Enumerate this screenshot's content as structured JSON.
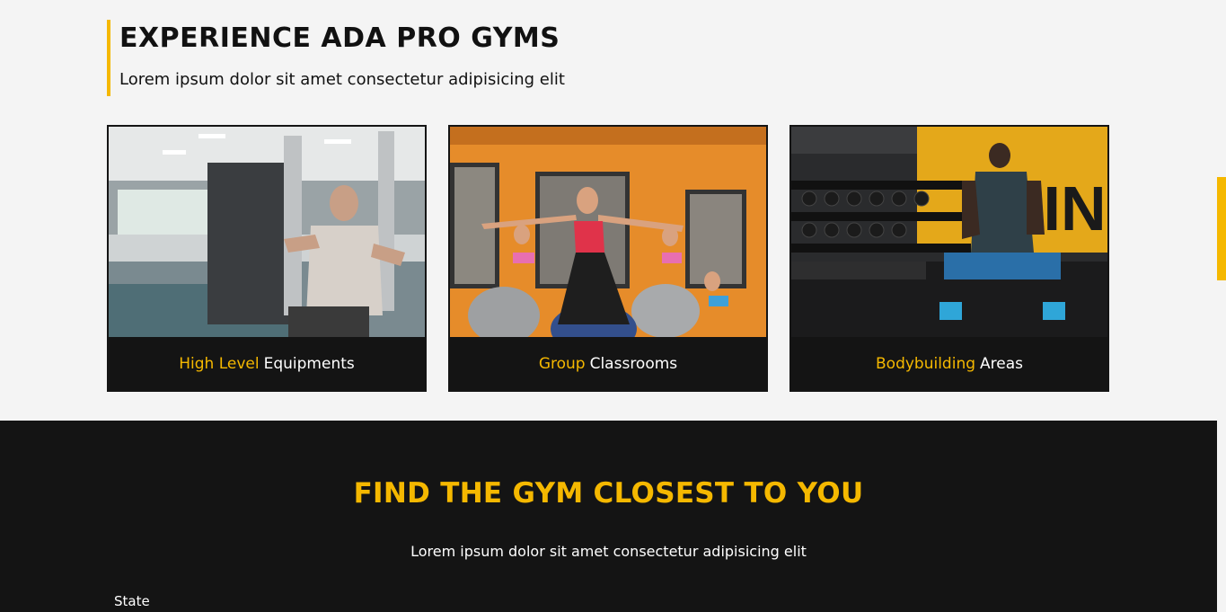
{
  "experience": {
    "title": "EXPERIENCE ADA PRO GYMS",
    "subtitle": "Lorem ipsum dolor sit amet consectetur adipisicing elit",
    "cards": [
      {
        "highlight": "High Level",
        "rest": "Equipments",
        "image": "gym-equipment-photo"
      },
      {
        "highlight": "Group",
        "rest": "Classrooms",
        "image": "group-class-photo"
      },
      {
        "highlight": "Bodybuilding",
        "rest": "Areas",
        "image": "bodybuilding-photo"
      }
    ]
  },
  "find": {
    "title": "FIND THE GYM CLOSEST TO YOU",
    "subtitle": "Lorem ipsum dolor sit amet consectetur adipisicing elit",
    "state_label": "State"
  },
  "colors": {
    "accent": "#f5b800",
    "dark": "#141414",
    "light": "#f4f4f4"
  }
}
